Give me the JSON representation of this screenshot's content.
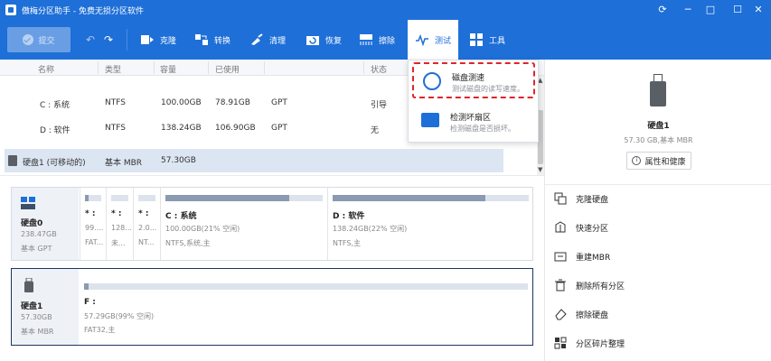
{
  "titlebar": {
    "title": "傲梅分区助手 - 免费无损分区软件",
    "controls": [
      "refresh-icon",
      "minimize-icon",
      "maximize-icon",
      "close-icon"
    ]
  },
  "toolbar": {
    "commit_label": "提交",
    "tools": [
      {
        "label": "克隆",
        "icon": "clone-icon"
      },
      {
        "label": "转换",
        "icon": "convert-icon"
      },
      {
        "label": "清理",
        "icon": "cleanup-icon"
      },
      {
        "label": "恢复",
        "icon": "recover-icon"
      },
      {
        "label": "擦除",
        "icon": "wipe-icon"
      },
      {
        "label": "测试",
        "icon": "test-icon",
        "active": true
      },
      {
        "label": "工具",
        "icon": "tools-icon"
      }
    ]
  },
  "table": {
    "columns": [
      "名称",
      "类型",
      "容量",
      "已使用",
      "",
      "状态"
    ],
    "rows": [
      {
        "name": "C : 系统",
        "type": "NTFS",
        "capacity": "100.00GB",
        "used": "78.91GB",
        "fs": "GPT",
        "status": "引导"
      },
      {
        "name": "D : 软件",
        "type": "NTFS",
        "capacity": "138.24GB",
        "used": "106.90GB",
        "fs": "GPT",
        "status": "无"
      },
      {
        "name": "硬盘1 (可移动的)",
        "type": "基本 MBR",
        "capacity": "57.30GB",
        "used": "",
        "fs": "",
        "status": ""
      }
    ]
  },
  "test_menu": {
    "items": [
      {
        "title": "磁盘测速",
        "desc": "测试磁盘的读写速度。",
        "icon": "speedometer-icon",
        "highlighted": true
      },
      {
        "title": "检测坏扇区",
        "desc": "检测磁盘是否损坏。",
        "icon": "bad-sector-icon",
        "highlighted": false
      }
    ]
  },
  "disks": [
    {
      "name": "硬盘0",
      "size": "238.47GB",
      "type": "基本 GPT",
      "partitions": [
        {
          "name": "* :",
          "free": "99....",
          "fs": "FAT...",
          "usage": 0.2
        },
        {
          "name": "* :",
          "free": "128...",
          "fs": "未...",
          "usage": 0.0
        },
        {
          "name": "* :",
          "free": "2.0...",
          "fs": "NT...",
          "usage": 0.0
        },
        {
          "name": "C : 系统",
          "free": "100.00GB(21% 空闲)",
          "fs": "NTFS,系统,主",
          "usage": 0.79
        },
        {
          "name": "D : 软件",
          "free": "138.24GB(22% 空闲)",
          "fs": "NTFS,主",
          "usage": 0.78
        }
      ]
    },
    {
      "name": "硬盘1",
      "size": "57.30GB",
      "type": "基本 MBR",
      "partitions": [
        {
          "name": "F :",
          "free": "57.29GB(99% 空闲)",
          "fs": "FAT32,主",
          "usage": 0.01
        }
      ]
    }
  ],
  "right_panel": {
    "device_name": "硬盘1",
    "device_info": "57.30 GB,基本 MBR",
    "properties_label": "属性和健康",
    "operations": [
      {
        "label": "克隆硬盘",
        "icon": "clone-disk-icon"
      },
      {
        "label": "快速分区",
        "icon": "quick-partition-icon"
      },
      {
        "label": "重建MBR",
        "icon": "rebuild-mbr-icon"
      },
      {
        "label": "删除所有分区",
        "icon": "trash-icon"
      },
      {
        "label": "擦除硬盘",
        "icon": "eraser-icon"
      },
      {
        "label": "分区碎片整理",
        "icon": "defrag-icon"
      }
    ]
  },
  "colors": {
    "brand_blue": "#1e6fd8",
    "highlight_red": "#e0242a",
    "selected_row": "#dce6f2",
    "usage_fill": "#8b9ab1"
  }
}
